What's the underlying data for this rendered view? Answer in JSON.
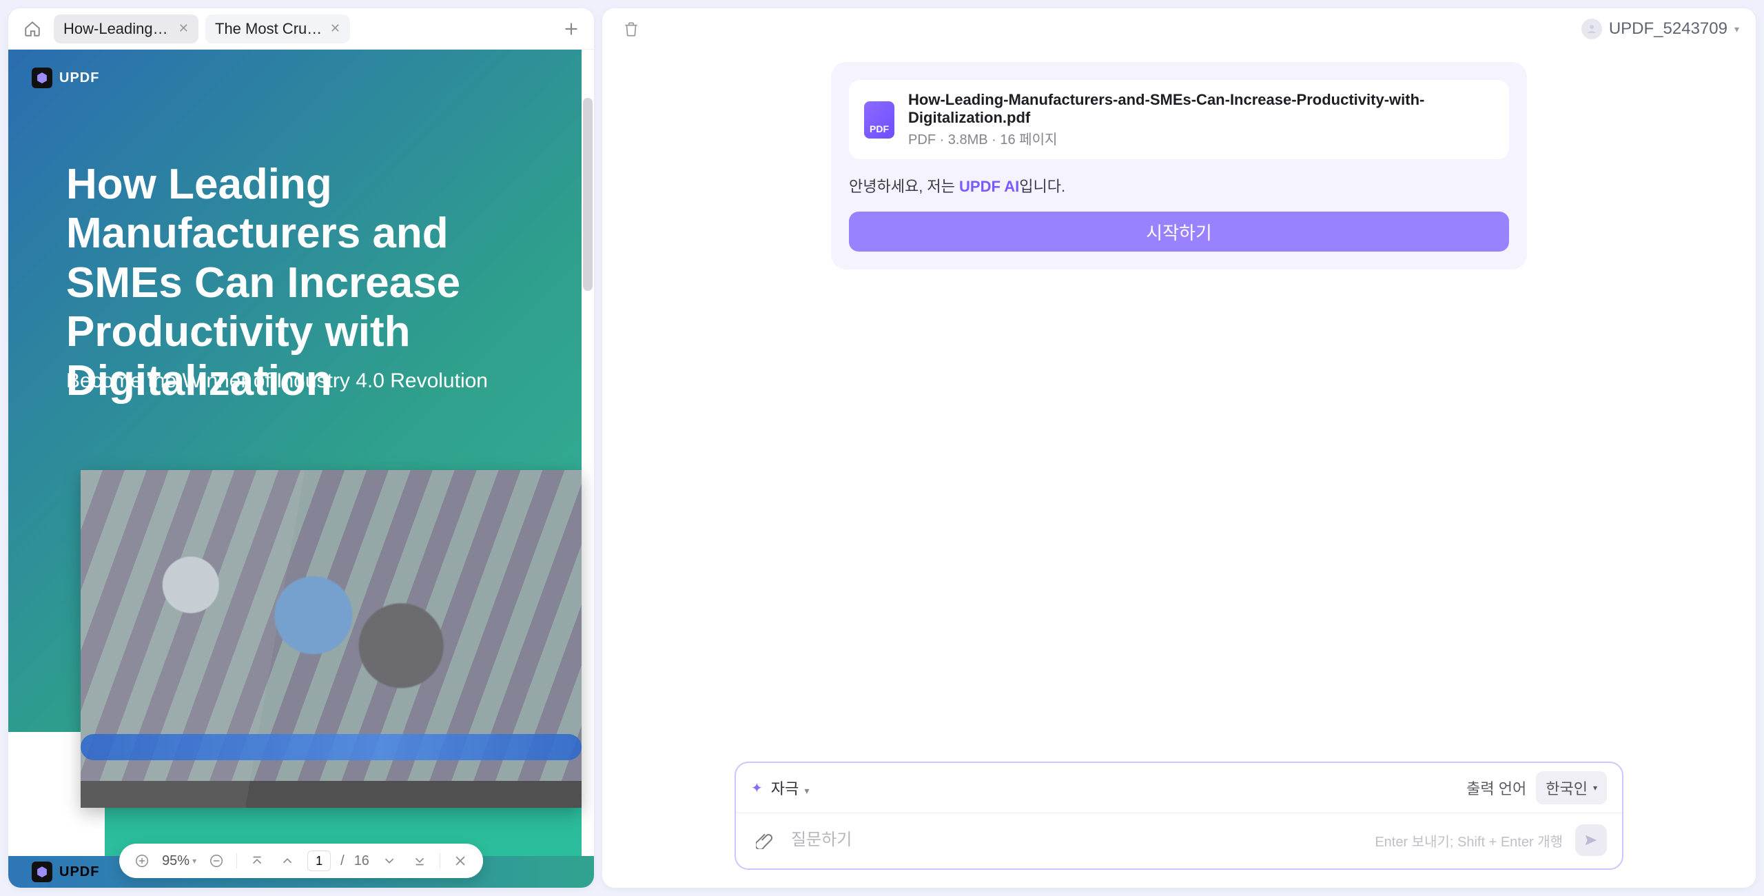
{
  "header": {
    "tabs": [
      {
        "label": "How-Leading-…"
      },
      {
        "label": "The Most Cruci…"
      }
    ],
    "user_name": "UPDF_5243709"
  },
  "document": {
    "brand": "UPDF",
    "title": "How Leading Manufacturers and SMEs Can Increase Productivity with Digitalization",
    "subtitle": "Become the Winner of Industry 4.0 Revolution"
  },
  "page_toolbar": {
    "zoom": "95%",
    "current_page": "1",
    "page_sep": "/",
    "total_pages": "16"
  },
  "ai": {
    "file": {
      "name": "How-Leading-Manufacturers-and-SMEs-Can-Increase-Productivity-with-Digitalization.pdf",
      "info": "PDF · 3.8MB · 16 페이지"
    },
    "greeting_prefix": "안녕하세요, 저는 ",
    "brand_link": "UPDF AI",
    "greeting_suffix": "입니다.",
    "start_label": "시작하기"
  },
  "composer": {
    "stimulus_label": "자극",
    "output_lang_label": "출력 언어",
    "lang_value": "한국인",
    "placeholder": "질문하기",
    "hint": "Enter 보내기; Shift + Enter 개행"
  }
}
